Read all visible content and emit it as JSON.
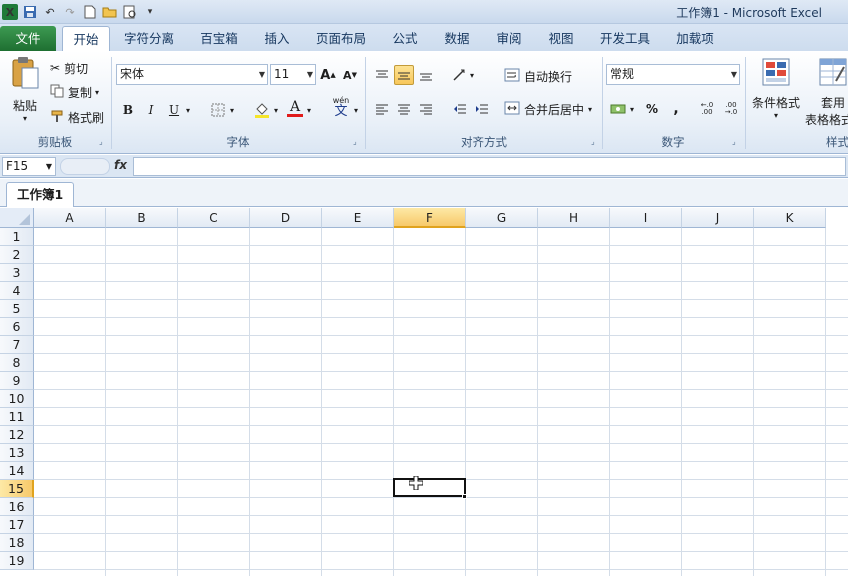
{
  "window": {
    "title": "工作簿1 - Microsoft Excel"
  },
  "quick_access": {
    "icons": [
      "excel-logo-icon",
      "save-icon",
      "undo-icon",
      "redo-icon",
      "new-icon",
      "open-icon",
      "print-preview-icon",
      "customize-icon"
    ]
  },
  "tabs": [
    {
      "label": "文件",
      "id": "file"
    },
    {
      "label": "开始",
      "id": "home",
      "active": true
    },
    {
      "label": "字符分离",
      "id": "char-split"
    },
    {
      "label": "百宝箱",
      "id": "toolbox"
    },
    {
      "label": "插入",
      "id": "insert"
    },
    {
      "label": "页面布局",
      "id": "page-layout"
    },
    {
      "label": "公式",
      "id": "formulas"
    },
    {
      "label": "数据",
      "id": "data"
    },
    {
      "label": "审阅",
      "id": "review"
    },
    {
      "label": "视图",
      "id": "view"
    },
    {
      "label": "开发工具",
      "id": "developer"
    },
    {
      "label": "加载项",
      "id": "addins"
    }
  ],
  "ribbon": {
    "clipboard": {
      "label": "剪贴板",
      "paste": "粘贴",
      "cut": "剪切",
      "copy": "复制",
      "format_painter": "格式刷"
    },
    "font": {
      "label": "字体",
      "font_name": "宋体",
      "font_size": "11",
      "bold": "B",
      "italic": "I",
      "underline": "U",
      "font_color": "A",
      "phonetic": "wén"
    },
    "alignment": {
      "label": "对齐方式",
      "wrap_text": "自动换行",
      "merge_center": "合并后居中"
    },
    "number": {
      "label": "数字",
      "format": "常规",
      "percent": "%",
      "comma": ",",
      "inc_decimal": "←.0 .00",
      "dec_decimal": ".00 →.0"
    },
    "styles": {
      "label": "样式",
      "conditional": "条件格式",
      "table_format_1": "套用",
      "table_format_2": "表格格式"
    }
  },
  "formula_bar": {
    "name_box": "F15",
    "fx": "fx",
    "value": ""
  },
  "workbook_tab": "工作簿1",
  "grid": {
    "columns": [
      "A",
      "B",
      "C",
      "D",
      "E",
      "F",
      "G",
      "H",
      "I",
      "J",
      "K"
    ],
    "rows": [
      "1",
      "2",
      "3",
      "4",
      "5",
      "6",
      "7",
      "8",
      "9",
      "10",
      "11",
      "12",
      "13",
      "14",
      "15",
      "16",
      "17",
      "18",
      "19"
    ],
    "selected_column": "F",
    "selected_row": "15"
  },
  "colors": {
    "accent": "#f7c96a",
    "file_tab": "#2a8540",
    "ribbon_border": "#9fb6d4"
  }
}
